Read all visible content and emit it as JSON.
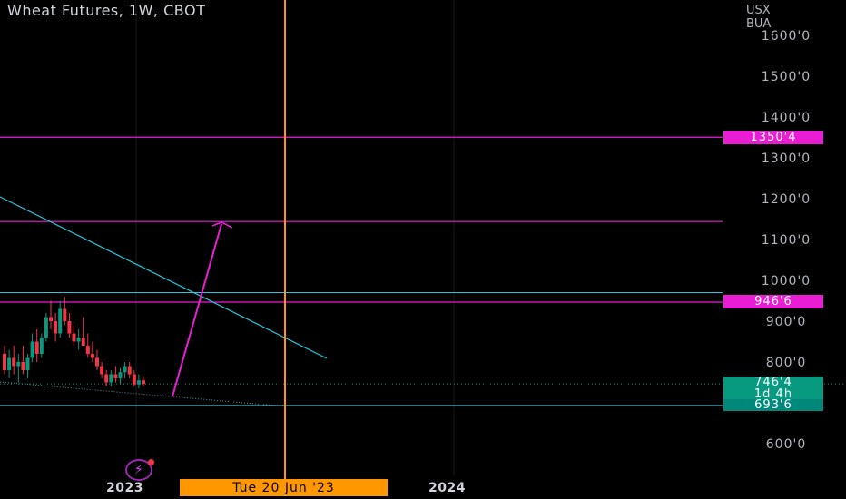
{
  "header": {
    "title": "Wheat Futures, 1W, CBOT",
    "currency_line1": "USX",
    "currency_line2": "BUA"
  },
  "badges": {
    "upper_level": "1350'4",
    "mid_level": "946'6",
    "last_price": "746'4",
    "countdown": "1d 4h",
    "lower_level": "693'6"
  },
  "xaxis": {
    "year_2023": "2023",
    "year_2024": "2024",
    "cursor_date": "Tue 20 Jun '23"
  },
  "colors": {
    "background": "#000000",
    "up": "#089981",
    "down": "#f23645",
    "magenta": "#e91ed4",
    "teal_line": "#26c6da",
    "cursor": "#ff9800"
  },
  "chart_data": {
    "type": "candlestick",
    "title": "Wheat Futures, 1W, CBOT",
    "unit": "USX/BUA",
    "ylim": [
      560,
      1630
    ],
    "y_ticks": [
      "1600'0",
      "1500'0",
      "1400'0",
      "1300'0",
      "1200'0",
      "1100'0",
      "1000'0",
      "900'0",
      "800'0",
      "600'0"
    ],
    "y_tick_values": [
      1600,
      1500,
      1400,
      1300,
      1200,
      1100,
      1000,
      900,
      800,
      600
    ],
    "horizontal_levels": [
      {
        "value": 1350.5,
        "label": "1350'4",
        "color": "#e91ed4"
      },
      {
        "value": 1144,
        "label": "",
        "color": "#e91ed4"
      },
      {
        "value": 970,
        "label": "",
        "color": "#26c6da"
      },
      {
        "value": 946.75,
        "label": "946'6",
        "color": "#e91ed4"
      },
      {
        "value": 693.75,
        "label": "693'6",
        "color": "#26c6da"
      }
    ],
    "last_price": 746.5,
    "candles": [
      {
        "o": 820,
        "h": 840,
        "l": 770,
        "c": 780
      },
      {
        "o": 780,
        "h": 830,
        "l": 760,
        "c": 810
      },
      {
        "o": 810,
        "h": 840,
        "l": 770,
        "c": 790
      },
      {
        "o": 790,
        "h": 820,
        "l": 750,
        "c": 800
      },
      {
        "o": 800,
        "h": 840,
        "l": 770,
        "c": 780
      },
      {
        "o": 780,
        "h": 820,
        "l": 760,
        "c": 810
      },
      {
        "o": 810,
        "h": 870,
        "l": 800,
        "c": 850
      },
      {
        "o": 850,
        "h": 880,
        "l": 800,
        "c": 820
      },
      {
        "o": 820,
        "h": 870,
        "l": 810,
        "c": 860
      },
      {
        "o": 860,
        "h": 920,
        "l": 850,
        "c": 910
      },
      {
        "o": 910,
        "h": 950,
        "l": 880,
        "c": 900
      },
      {
        "o": 900,
        "h": 920,
        "l": 850,
        "c": 870
      },
      {
        "o": 870,
        "h": 950,
        "l": 860,
        "c": 930
      },
      {
        "o": 930,
        "h": 960,
        "l": 890,
        "c": 900
      },
      {
        "o": 900,
        "h": 920,
        "l": 860,
        "c": 870
      },
      {
        "o": 870,
        "h": 890,
        "l": 840,
        "c": 850
      },
      {
        "o": 850,
        "h": 880,
        "l": 830,
        "c": 860
      },
      {
        "o": 860,
        "h": 910,
        "l": 840,
        "c": 840
      },
      {
        "o": 840,
        "h": 870,
        "l": 810,
        "c": 820
      },
      {
        "o": 820,
        "h": 850,
        "l": 800,
        "c": 810
      },
      {
        "o": 810,
        "h": 830,
        "l": 780,
        "c": 790
      },
      {
        "o": 790,
        "h": 800,
        "l": 760,
        "c": 770
      },
      {
        "o": 770,
        "h": 780,
        "l": 740,
        "c": 750
      },
      {
        "o": 750,
        "h": 780,
        "l": 740,
        "c": 770
      },
      {
        "o": 770,
        "h": 790,
        "l": 750,
        "c": 760
      },
      {
        "o": 760,
        "h": 785,
        "l": 745,
        "c": 775
      },
      {
        "o": 775,
        "h": 800,
        "l": 760,
        "c": 790
      },
      {
        "o": 790,
        "h": 800,
        "l": 760,
        "c": 770
      },
      {
        "o": 770,
        "h": 780,
        "l": 740,
        "c": 745
      },
      {
        "o": 745,
        "h": 770,
        "l": 735,
        "c": 755
      },
      {
        "o": 755,
        "h": 765,
        "l": 740,
        "c": 746.5
      }
    ]
  }
}
